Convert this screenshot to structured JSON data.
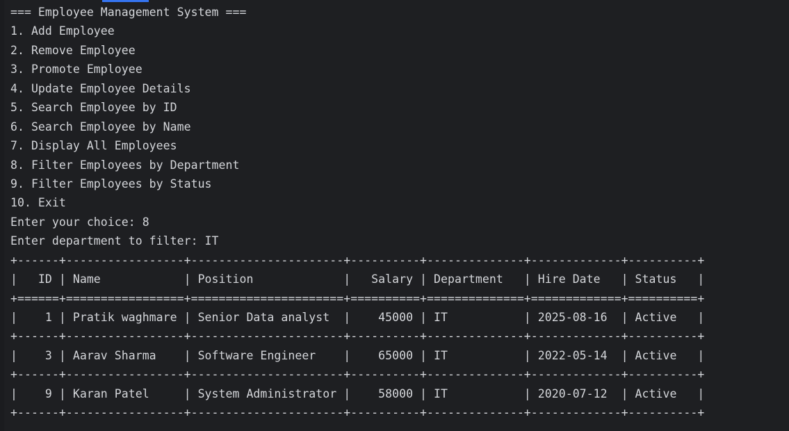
{
  "console": {
    "menu": {
      "title": "=== Employee Management System ===",
      "options": [
        "1. Add Employee",
        "2. Remove Employee",
        "3. Promote Employee",
        "4. Update Employee Details",
        "5. Search Employee by ID",
        "6. Search Employee by Name",
        "7. Display All Employees",
        "8. Filter Employees by Department",
        "9. Filter Employees by Status",
        "10. Exit"
      ]
    },
    "prompts": {
      "choice": "Enter your choice: 8",
      "department": "Enter department to filter: IT"
    },
    "table": {
      "border": "+------+-----------------+----------------------+----------+--------------+-------------+----------+",
      "header": "|   ID | Name            | Position             |   Salary | Department   | Hire Date   | Status   |",
      "header_separator": "+======+=================+======================+==========+==============+=============+==========+",
      "rows": [
        "|    1 | Pratik waghmare | Senior Data analyst  |    45000 | IT           | 2025-08-16  | Active   |",
        "|    3 | Aarav Sharma    | Software Engineer    |    65000 | IT           | 2022-05-14  | Active   |",
        "|    9 | Karan Patel     | System Administrator |    58000 | IT           | 2020-07-12  | Active   |"
      ]
    }
  },
  "colors": {
    "background": "#1e1f22",
    "text": "#d4d6da",
    "accent": "#3574f0"
  }
}
